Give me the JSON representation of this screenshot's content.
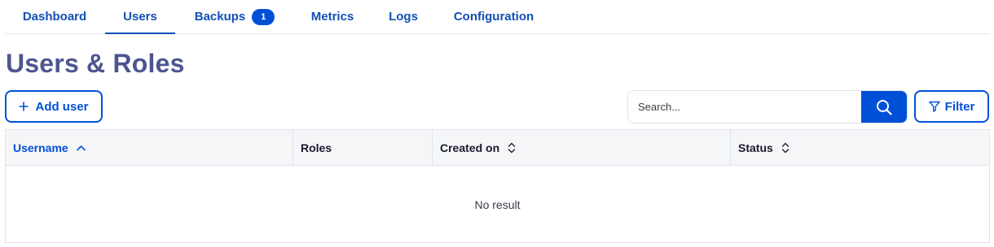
{
  "tabs": [
    {
      "label": "Dashboard"
    },
    {
      "label": "Users"
    },
    {
      "label": "Backups",
      "badge": "1"
    },
    {
      "label": "Metrics"
    },
    {
      "label": "Logs"
    },
    {
      "label": "Configuration"
    }
  ],
  "active_tab": "Users",
  "page": {
    "title": "Users & Roles"
  },
  "toolbar": {
    "add_user_label": "Add user",
    "search_placeholder": "Search...",
    "filter_label": "Filter"
  },
  "table": {
    "columns": [
      {
        "label": "Username",
        "sort": "ascending"
      },
      {
        "label": "Roles",
        "sort": "none"
      },
      {
        "label": "Created on",
        "sort": "unsorted"
      },
      {
        "label": "Status",
        "sort": "unsorted"
      }
    ],
    "empty_message": "No result"
  },
  "colors": {
    "accent": "#0050d7",
    "title": "#4d5590",
    "tab_text": "#1150b5"
  }
}
